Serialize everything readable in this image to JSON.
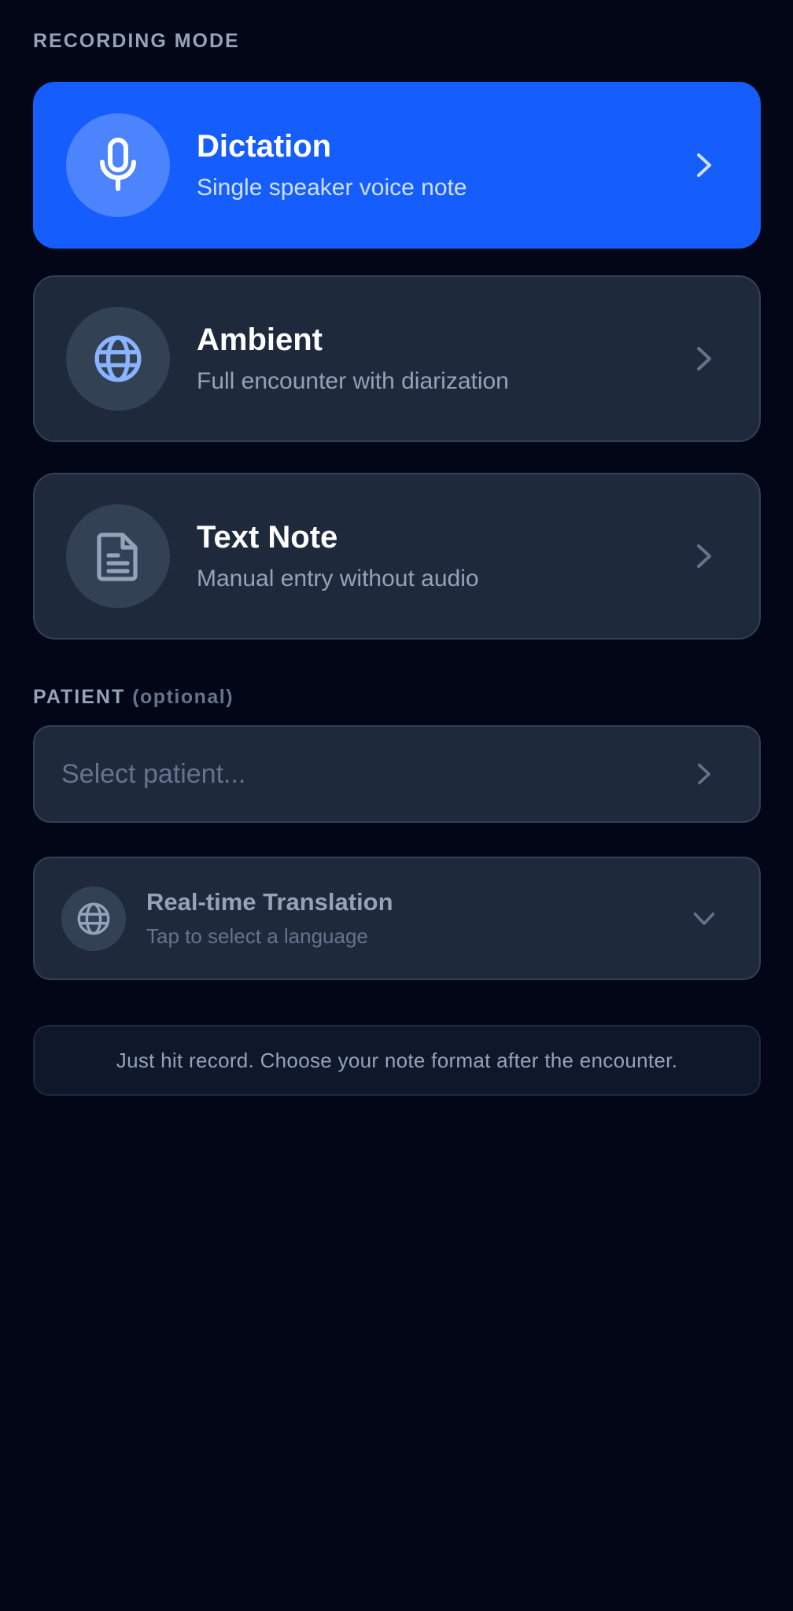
{
  "recording_mode": {
    "label": "RECORDING MODE",
    "modes": [
      {
        "title": "Dictation",
        "subtitle": "Single speaker voice note",
        "icon": "microphone-icon",
        "selected": true
      },
      {
        "title": "Ambient",
        "subtitle": "Full encounter with diarization",
        "icon": "globe-icon",
        "selected": false
      },
      {
        "title": "Text Note",
        "subtitle": "Manual entry without audio",
        "icon": "document-icon",
        "selected": false
      }
    ]
  },
  "patient": {
    "label": "PATIENT",
    "optional_label": "(optional)",
    "placeholder": "Select patient..."
  },
  "translation": {
    "title": "Real-time Translation",
    "subtitle": "Tap to select a language"
  },
  "hint": "Just hit record. Choose your note format after the encounter.",
  "colors": {
    "background": "#020617",
    "card": "#1e293b",
    "accent": "#155dfc",
    "muted_text": "#94a3b8"
  }
}
